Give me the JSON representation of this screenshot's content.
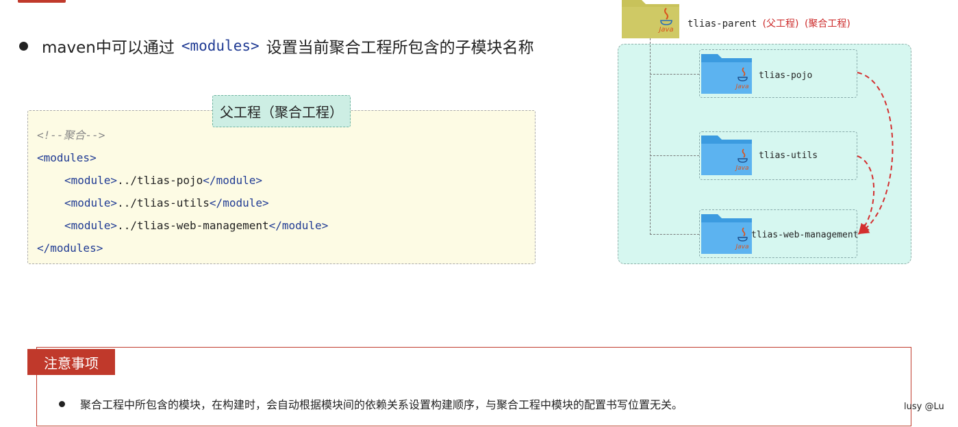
{
  "bullet": {
    "prefix": "maven中可以通过",
    "tag": "<modules>",
    "suffix": "设置当前聚合工程所包含的子模块名称"
  },
  "code_box": {
    "title": "父工程（聚合工程）",
    "comment": "<!--聚合-->",
    "open_tag": "<modules>",
    "close_tag": "</modules>",
    "modules": [
      {
        "open": "<module>",
        "path": "../tlias-pojo",
        "close": "</module>"
      },
      {
        "open": "<module>",
        "path": "../tlias-utils",
        "close": "</module>"
      },
      {
        "open": "<module>",
        "path": "../tlias-web-management",
        "close": "</module>"
      }
    ]
  },
  "tree": {
    "parent_name": "tlias-parent",
    "parent_tag1": "(父工程)",
    "parent_tag2": "(聚合工程)",
    "folder_icon_text": "Java",
    "modules": [
      "tlias-pojo",
      "tlias-utils",
      "tlias-web-management"
    ]
  },
  "notice": {
    "title": "注意事项",
    "text": "聚合工程中所包含的模块，在构建时，会自动根据模块间的依赖关系设置构建顺序，与聚合工程中模块的配置书写位置无关。"
  },
  "watermark": "lusy @Lu",
  "colors": {
    "accent_red": "#c0392b",
    "tag_blue": "#1f3a93",
    "panel_teal": "#d6f7f0",
    "code_bg": "#fdfbe4",
    "folder_blue": "#4aa8ee",
    "folder_olive": "#c8c25a"
  }
}
